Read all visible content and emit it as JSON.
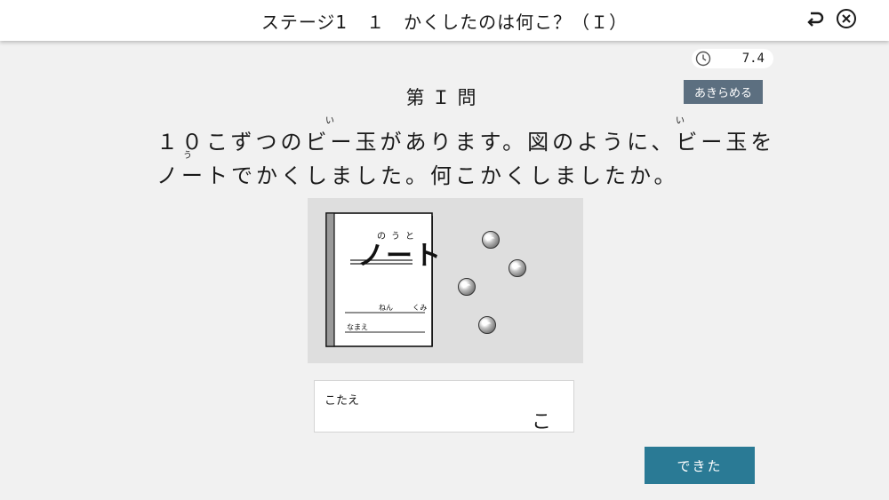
{
  "header": {
    "title": "ステージ1　１　かくしたのは何こ？（Ｉ）",
    "back_icon": "return-arrow-icon",
    "close_icon": "circle-x-icon"
  },
  "timer": {
    "icon": "clock-icon",
    "value": "7.4"
  },
  "give_up_label": "あきらめる",
  "question": {
    "number_label": "第Ｉ問",
    "line1": "１０こずつのビー玉があります。図のように、ビー玉を",
    "line2": "ノートでかくしました。何こかくしましたか。",
    "furigana_tama": "い",
    "furigana_nooto": "う"
  },
  "figure": {
    "notebook": {
      "furigana": "のうと",
      "title": "ノート",
      "nen_label": "ねん",
      "kumi_label": "くみ",
      "name_label": "なまえ"
    },
    "visible_marbles": 4
  },
  "answer": {
    "label": "こたえ",
    "value": "",
    "unit": "こ"
  },
  "done_label": "できた",
  "colors": {
    "background": "#f1f1f1",
    "give_up_button": "#5c6f80",
    "done_button": "#2a7a95",
    "figure_background": "#dedede"
  }
}
